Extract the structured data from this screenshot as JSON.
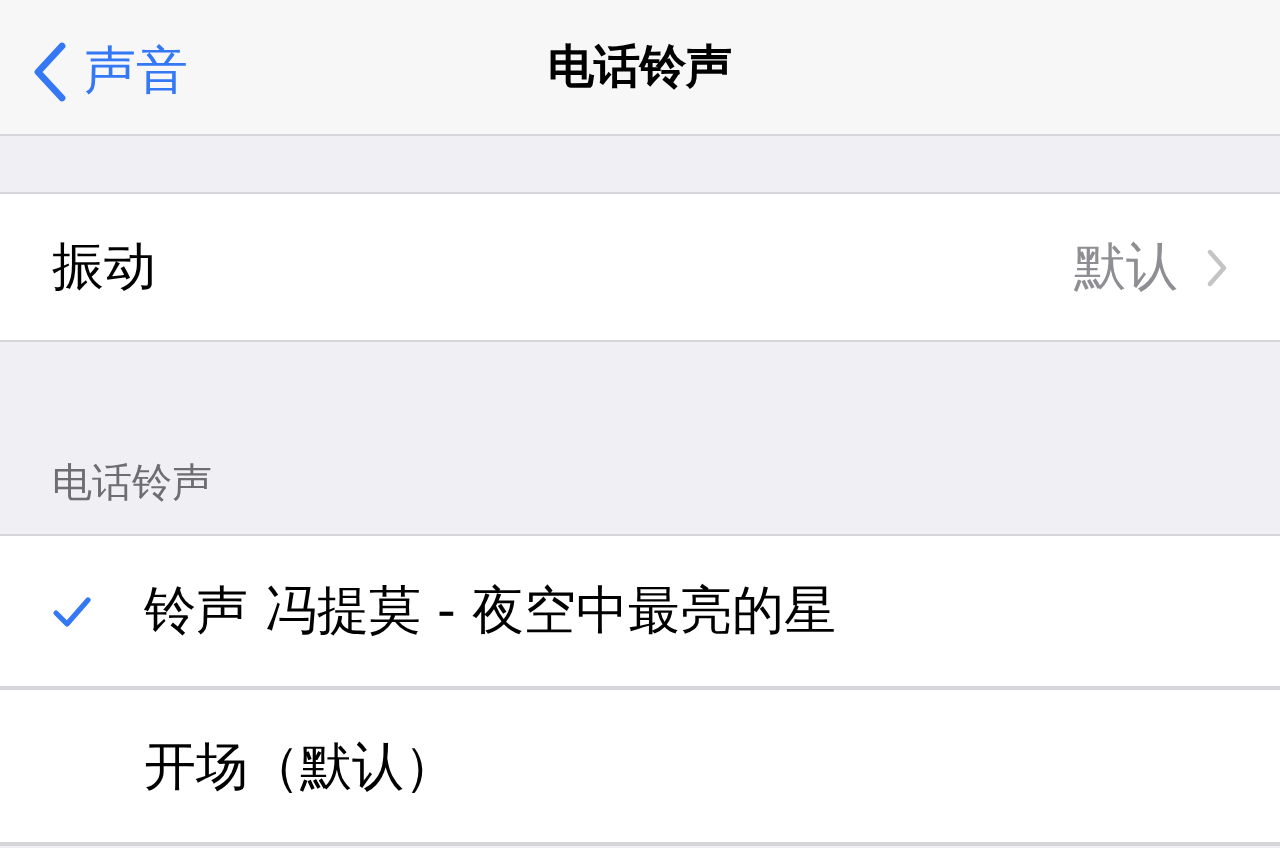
{
  "nav": {
    "back_label": "声音",
    "title": "电话铃声"
  },
  "vibration_row": {
    "label": "振动",
    "value": "默认"
  },
  "section_header": "电话铃声",
  "ringtones": [
    {
      "label": "铃声 冯提莫 - 夜空中最亮的星",
      "selected": true
    },
    {
      "label": "开场（默认）",
      "selected": false
    }
  ]
}
